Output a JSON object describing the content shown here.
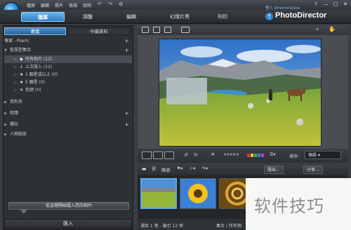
{
  "menu": {
    "items": [
      "檔案",
      "編輯",
      "照片",
      "檢視",
      "說明"
    ]
  },
  "window": {
    "dz_link": "登入 DirectorZone",
    "help": "?",
    "minimize": "—",
    "maximize": "□",
    "close": "✕"
  },
  "modes": {
    "library": "匯庫",
    "adjust": "調整",
    "edit": "編輯",
    "slideshow": "幻燈片秀",
    "print": "列印"
  },
  "brand": {
    "name": "PhotoDirector",
    "icon": "↑"
  },
  "left_panel": {
    "tabs": {
      "projects": "專案",
      "tags": "中繼資料"
    },
    "project_header": "專案 - Pseric",
    "smart_collections": "智慧型集合",
    "smart_items": [
      {
        "label": "所有相片 (12)",
        "icon": "◆"
      },
      {
        "label": "上次匯入 (12)",
        "icon": "↓"
      },
      {
        "label": "1 顆星或以上 (0)",
        "icon": "★"
      },
      {
        "label": "5 顆星 (0)",
        "icon": "★"
      },
      {
        "label": "拒絕 (0)",
        "icon": "✕"
      }
    ],
    "sections": [
      "資料夾",
      "相簿",
      "標記",
      "人物臉部"
    ],
    "import_prompt": "從這裡開始匯入您的相片",
    "import_button": "匯入"
  },
  "viewer": {
    "sort_label": "排序:",
    "sort_value": "預設 ▾"
  },
  "filterbar": {
    "filter_label": "篩選:",
    "export_label": "匯出...",
    "share_label": "分享..."
  },
  "status": {
    "left": "選取 1 張 - 顯示 12 張",
    "right": "集合 / 所有相"
  },
  "watermark": {
    "text": "软件技巧"
  },
  "colors": {
    "accent": "#2f7fc2",
    "panel": "#2d3035",
    "sky": "#4a90d9",
    "grass": "#7dab2f"
  }
}
